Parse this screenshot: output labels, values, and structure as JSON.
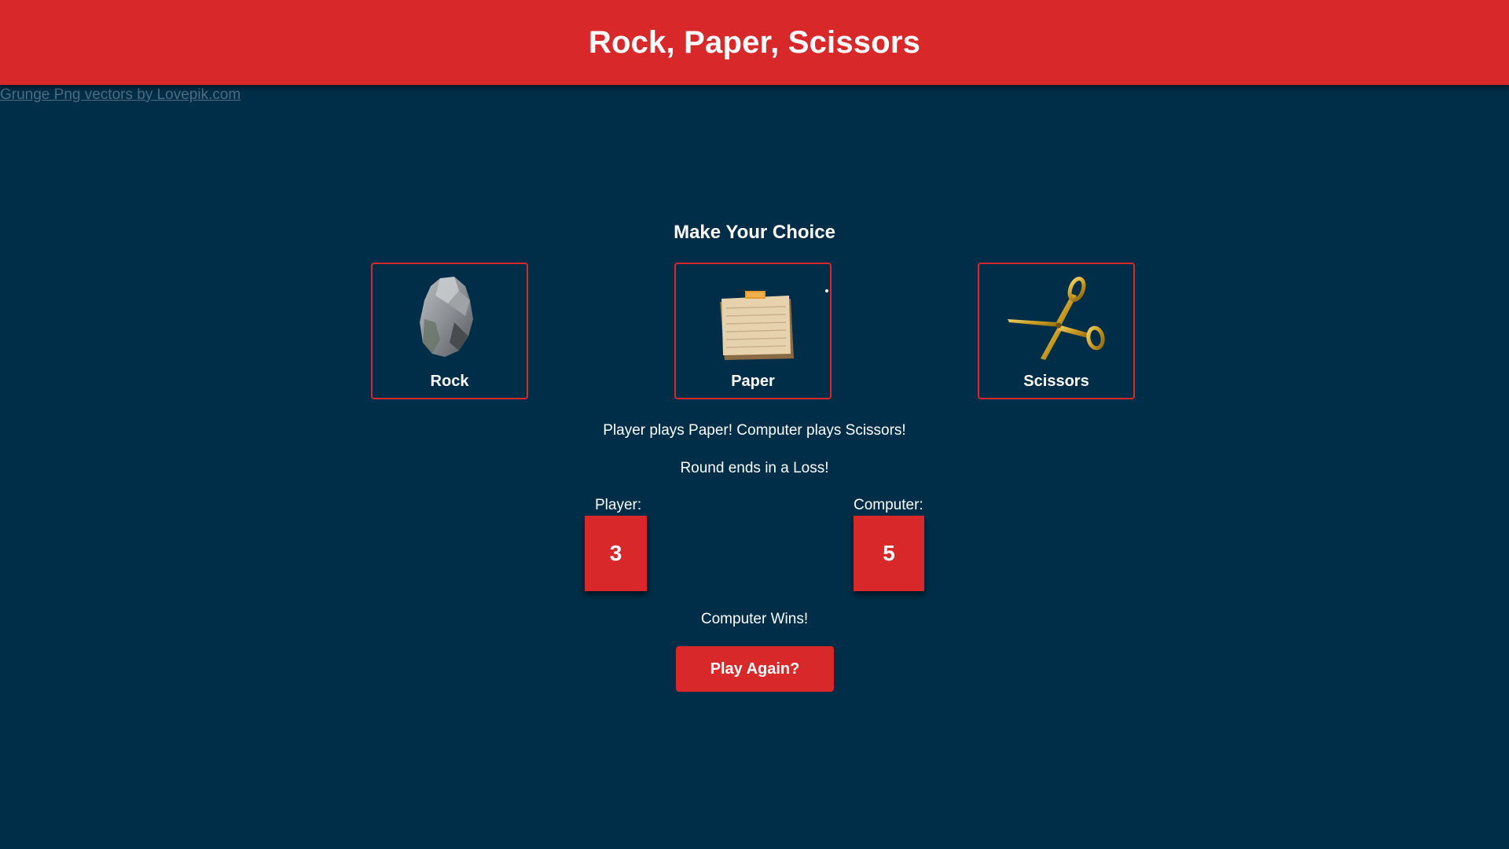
{
  "header": {
    "title": "Rock, Paper, Scissors"
  },
  "credit": {
    "text": "Grunge Png vectors by Lovepik.com"
  },
  "choices": {
    "heading": "Make Your Choice",
    "items": [
      {
        "label": "Rock",
        "icon": "rock-icon"
      },
      {
        "label": "Paper",
        "icon": "paper-icon"
      },
      {
        "label": "Scissors",
        "icon": "scissors-icon"
      }
    ]
  },
  "round": {
    "play_text": "Player plays Paper! Computer plays Scissors!",
    "result_text": "Round ends in a Loss!"
  },
  "score": {
    "player_label": "Player:",
    "player_value": "3",
    "computer_label": "Computer:",
    "computer_value": "5"
  },
  "final": {
    "result_text": "Computer Wins!",
    "play_again_label": "Play Again?"
  },
  "colors": {
    "background": "#002e48",
    "accent": "#d8282a",
    "text": "#ffffff",
    "link": "#4d6c80"
  }
}
